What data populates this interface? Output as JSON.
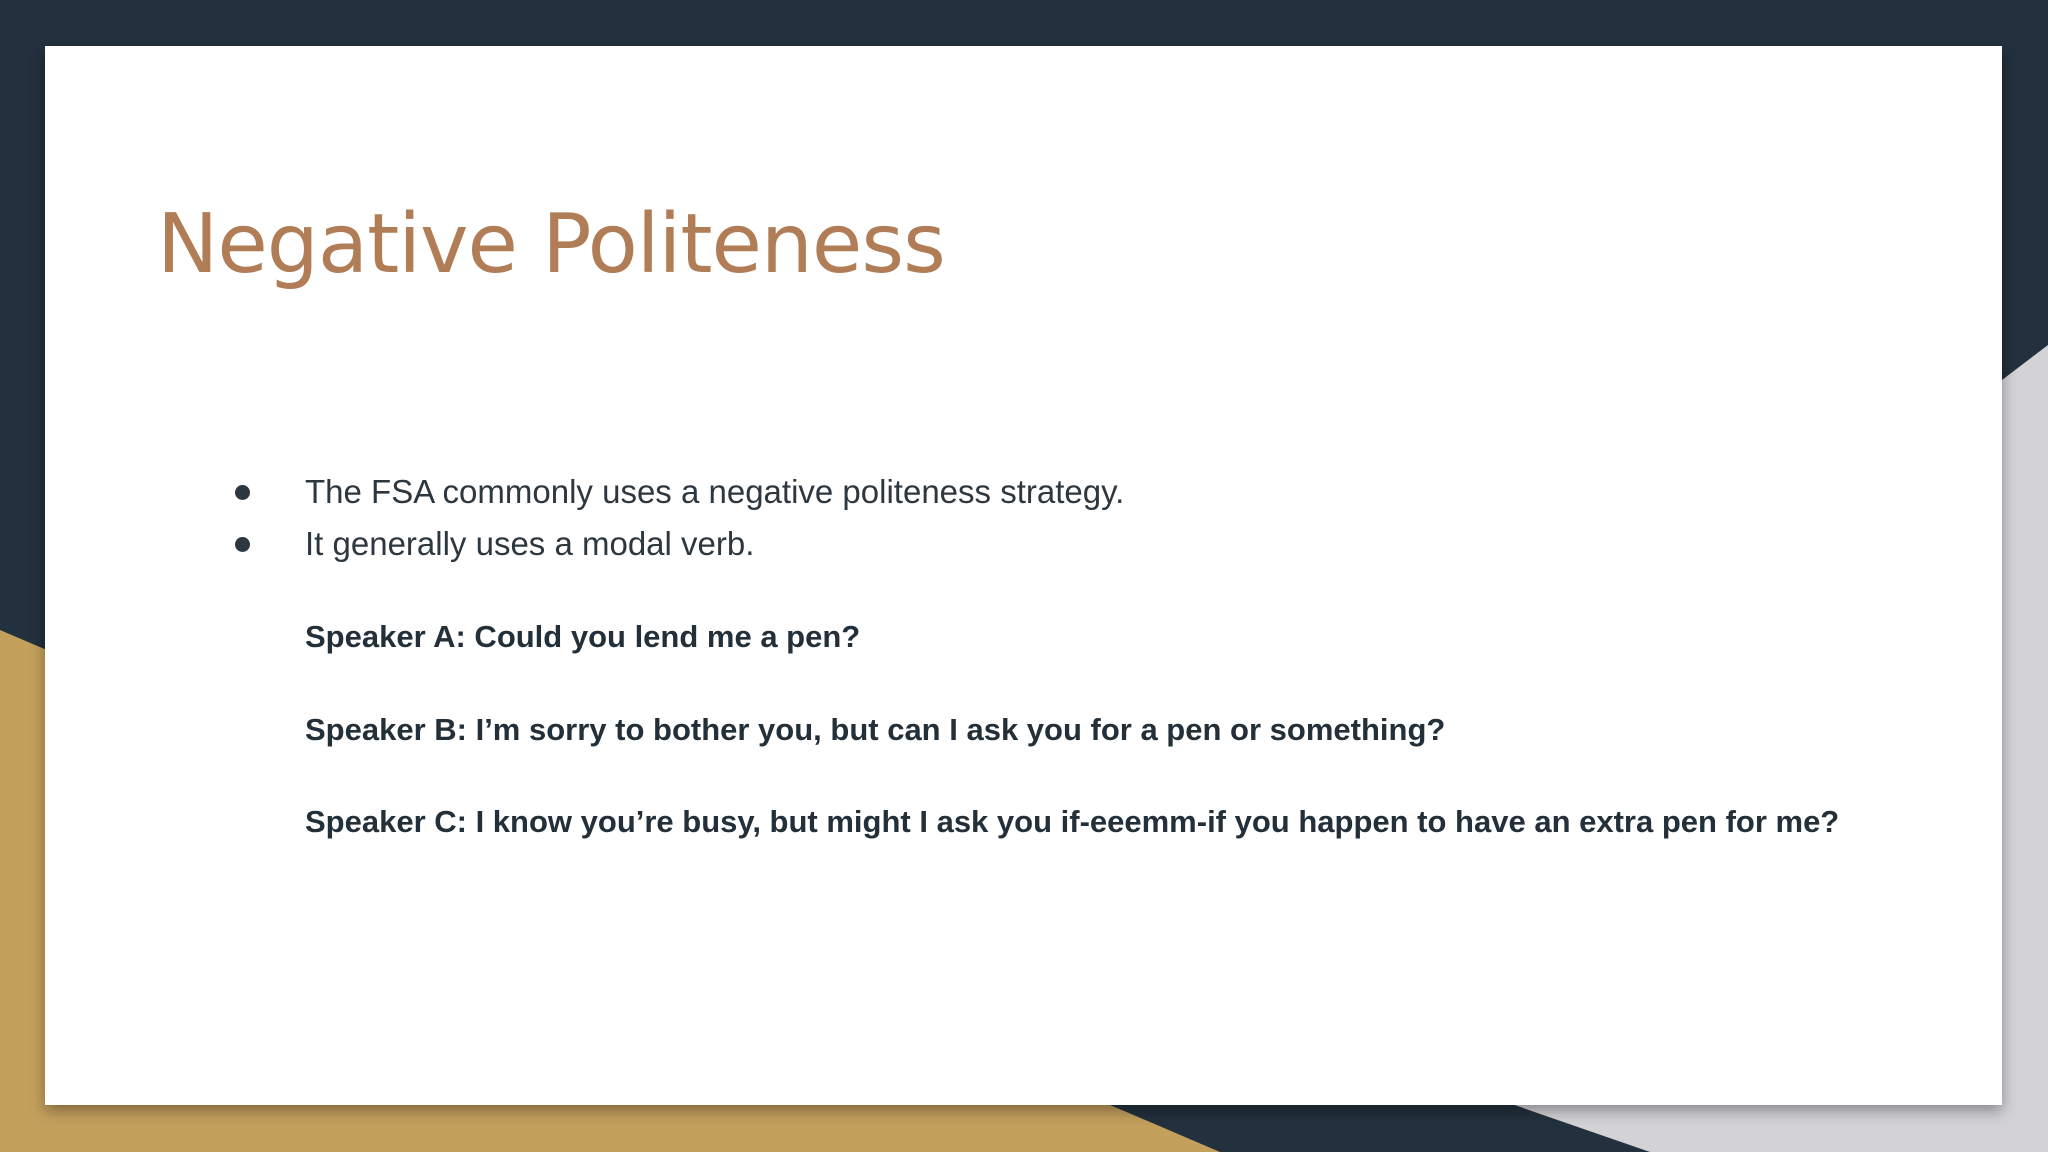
{
  "slide": {
    "title": "Negative Politeness",
    "bullets": [
      "The FSA commonly uses a negative politeness strategy.",
      "It generally uses a modal verb."
    ],
    "examples": [
      "Speaker A: Could you lend me a pen?",
      "Speaker B: I’m sorry to bother you, but can I ask you for a pen or something?",
      "Speaker C: I know you’re busy, but might I ask you if-eeemm-if you happen to have an extra pen for me?"
    ]
  },
  "colors": {
    "background_dark": "#22313d",
    "accent_gold": "#c4a05d",
    "accent_gray": "#d3d3d6",
    "title": "#b07d56",
    "body_text": "#2d3740"
  }
}
